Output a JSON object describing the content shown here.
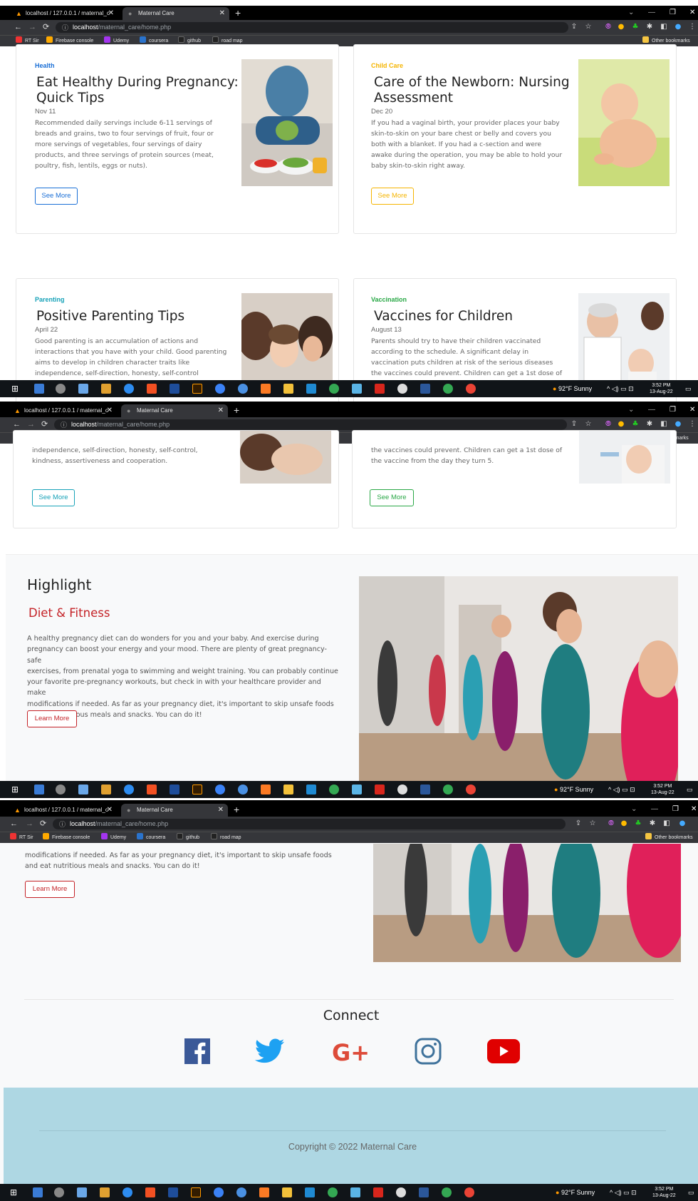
{
  "browser": {
    "tab1_title": "localhost / 127.0.0.1 / maternal_c",
    "tab2_title": "Maternal Care",
    "url_host": "localhost",
    "url_path": "/maternal_care/home.php",
    "bookmarks": [
      "RT Sir",
      "Firebase console",
      "Udemy",
      "coursera",
      "github",
      "road map"
    ],
    "other_bookmarks": "Other bookmarks"
  },
  "taskbar": {
    "weather": "92°F  Sunny",
    "time": "3:52 PM",
    "date": "13-Aug-22"
  },
  "cards": [
    {
      "category": "Health",
      "category_color": "#1a6fd6",
      "title_line1": "Eat Healthy During Pregnancy:",
      "title_line2": "Quick Tips",
      "date": "Nov 11",
      "desc_lines": [
        "Recommended daily servings include 6-11 servings of",
        "breads and grains, two to four servings of fruit, four or",
        "more servings of vegetables, four servings of dairy",
        "products, and three servings of protein sources (meat,",
        "poultry, fish, lentils, eggs or nuts)."
      ],
      "button": "See More",
      "button_color": "#1a6fd6"
    },
    {
      "category": "Child Care",
      "category_color": "#f5b400",
      "title_line1": "Care of the Newborn: Nursing",
      "title_line2": "Assessment",
      "date": "Dec 20",
      "desc_lines": [
        "If you had a vaginal birth, your provider places your baby",
        "skin-to-skin on your bare chest or belly and covers you",
        "both with a blanket. If you had a c-section and were",
        "awake during the operation, you may be able to hold your",
        "baby skin-to-skin right away."
      ],
      "button": "See More",
      "button_color": "#f5b400"
    },
    {
      "category": "Parenting",
      "category_color": "#17a2b8",
      "title_line1": "Positive Parenting Tips",
      "title_line2": "",
      "date": "April 22",
      "desc_lines": [
        "Good parenting is an accumulation of actions and",
        "interactions that you have with your child. Good parenting",
        "aims to develop in children character traits like",
        "independence, self-direction, honesty, self-control"
      ],
      "desc_lines_cont": [
        "independence, self-direction, honesty, self-control,",
        "kindness, assertiveness and cooperation."
      ],
      "button": "See More",
      "button_color": "#17a2b8"
    },
    {
      "category": "Vaccination",
      "category_color": "#28a745",
      "title_line1": "Vaccines for Children",
      "title_line2": "",
      "date": "August 13",
      "desc_lines": [
        "Parents should try to have their children vaccinated",
        "according to the schedule. A significant delay in",
        "vaccination puts children at risk of the serious diseases",
        "the vaccines could prevent. Children can get a 1st dose of"
      ],
      "desc_lines_cont": [
        "the vaccines could prevent. Children can get a 1st dose of",
        "the vaccine from the day they turn 5."
      ],
      "button": "See More",
      "button_color": "#28a745"
    }
  ],
  "highlight": {
    "title": "Highlight",
    "subtitle": "Diet & Fitness",
    "desc_lines": [
      "A healthy pregnancy diet can do wonders for you and your baby. And exercise during",
      "pregnancy can boost your energy and your mood. There are plenty of great pregnancy-safe",
      "exercises, from prenatal yoga to swimming and weight training. You can probably continue",
      "your favorite pre-pregnancy workouts, but check in with your healthcare provider and make",
      "modifications if needed. As far as your pregnancy diet, it's important to skip unsafe foods",
      "and eat nutritious meals and snacks. You can do it!"
    ],
    "desc_lines_cont": [
      "modifications if needed. As far as your pregnancy diet, it's important to skip unsafe foods",
      "and eat nutritious meals and snacks. You can do it!"
    ],
    "button": "Learn More",
    "button_color": "#c42126"
  },
  "connect": {
    "title": "Connect",
    "icons": [
      "facebook-icon",
      "twitter-icon",
      "google-plus-icon",
      "instagram-icon",
      "youtube-icon"
    ],
    "colors": {
      "facebook": "#3b5998",
      "twitter": "#1da1f2",
      "google": "#dd4b39",
      "instagram": "#3f729b",
      "youtube": "#e00000"
    }
  },
  "footer": {
    "copyright": "Copyright © 2022 Maternal Care",
    "bg": "#aed7e3"
  }
}
